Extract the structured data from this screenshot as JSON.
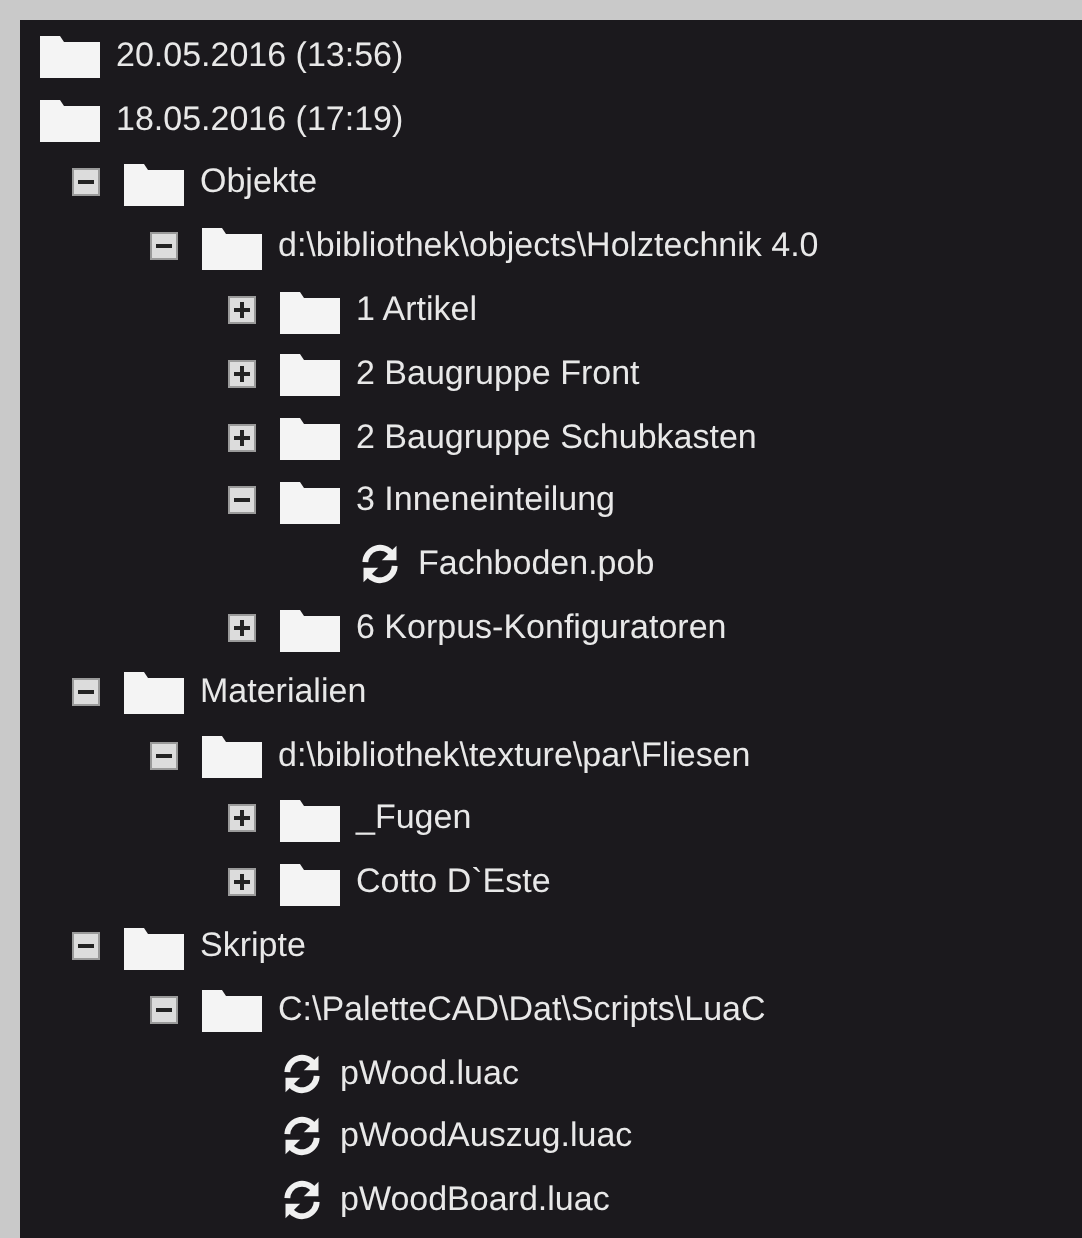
{
  "sessions": [
    {
      "label": "20.05.2016 (13:56)"
    },
    {
      "label": "18.05.2016 (17:19)",
      "children": [
        {
          "kind": "folder",
          "label": "Objekte",
          "expanded": true,
          "children": [
            {
              "kind": "folder",
              "label": "d:\\bibliothek\\objects\\Holztechnik 4.0",
              "expanded": true,
              "children": [
                {
                  "kind": "folder",
                  "label": "1 Artikel",
                  "expanded": false
                },
                {
                  "kind": "folder",
                  "label": "2 Baugruppe Front",
                  "expanded": false
                },
                {
                  "kind": "folder",
                  "label": "2 Baugruppe Schubkasten",
                  "expanded": false
                },
                {
                  "kind": "folder",
                  "label": "3 Inneneinteilung",
                  "expanded": true,
                  "children": [
                    {
                      "kind": "file",
                      "label": "Fachboden.pob"
                    }
                  ]
                },
                {
                  "kind": "folder",
                  "label": "6 Korpus-Konfiguratoren",
                  "expanded": false
                }
              ]
            }
          ]
        },
        {
          "kind": "folder",
          "label": "Materialien",
          "expanded": true,
          "children": [
            {
              "kind": "folder",
              "label": "d:\\bibliothek\\texture\\par\\Fliesen",
              "expanded": true,
              "children": [
                {
                  "kind": "folder",
                  "label": "_Fugen",
                  "expanded": false
                },
                {
                  "kind": "folder",
                  "label": "Cotto D`Este",
                  "expanded": false
                }
              ]
            }
          ]
        },
        {
          "kind": "folder",
          "label": "Skripte",
          "expanded": true,
          "children": [
            {
              "kind": "folder",
              "label": "C:\\PaletteCAD\\Dat\\Scripts\\LuaC",
              "expanded": true,
              "children": [
                {
                  "kind": "file",
                  "label": "pWood.luac"
                },
                {
                  "kind": "file",
                  "label": "pWoodAuszug.luac"
                },
                {
                  "kind": "file",
                  "label": "pWoodBoard.luac"
                }
              ]
            }
          ]
        }
      ]
    }
  ]
}
